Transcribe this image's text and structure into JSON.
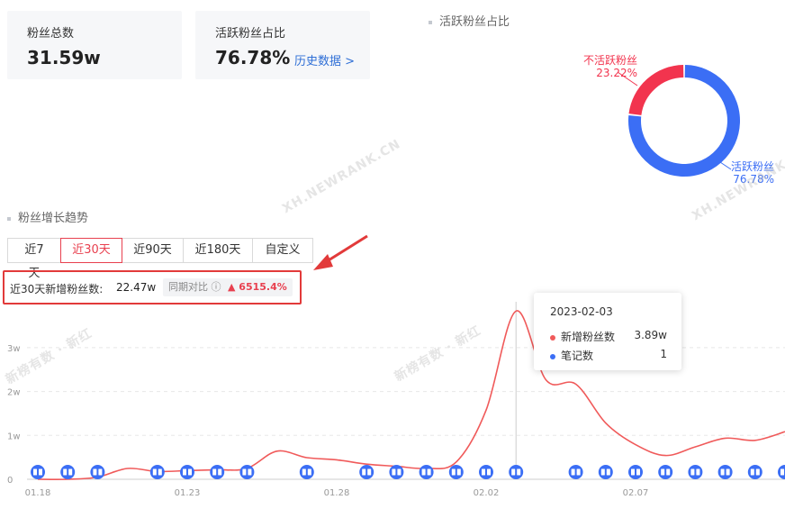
{
  "stats": {
    "fans_total_label": "粉丝总数",
    "fans_total_value": "31.59w",
    "active_ratio_label": "活跃粉丝占比",
    "active_ratio_value": "76.78%",
    "history_link": "历史数据 >"
  },
  "donut": {
    "title": "活跃粉丝占比",
    "inactive_label": "不活跃粉丝",
    "inactive_pct": "23.22%",
    "active_label": "活跃粉丝",
    "active_pct": "76.78%",
    "inactive_value": 23.22,
    "active_value": 76.78,
    "inactive_color": "#f2344e",
    "active_color": "#3b6ef5"
  },
  "trend": {
    "title": "粉丝增长趋势",
    "tabs": [
      "近7天",
      "近30天",
      "近90天",
      "近180天",
      "自定义"
    ],
    "active_tab": "近30天",
    "summary_label": "近30天新增粉丝数:",
    "summary_value": "22.47w",
    "yoy_label": "同期对比",
    "yoy_change": "6515.4%"
  },
  "tooltip": {
    "date": "2023-02-03",
    "row1_label": "新增粉丝数",
    "row1_value": "3.89w",
    "row2_label": "笔记数",
    "row2_value": "1"
  },
  "watermarks": [
    "XH.NEWRANK.CN",
    "XH.NEWRANK.CN",
    "新榜有数 · 新红",
    "新榜有数 · 新红"
  ],
  "chart_data": {
    "type": "line",
    "x": [
      "01.18",
      "01.19",
      "01.20",
      "01.21",
      "01.22",
      "01.23",
      "01.24",
      "01.25",
      "01.26",
      "01.27",
      "01.28",
      "01.29",
      "01.30",
      "01.31",
      "02.01",
      "02.02",
      "02.03",
      "02.04",
      "02.05",
      "02.06",
      "02.07",
      "02.08",
      "02.09",
      "02.10",
      "02.11",
      "02.12"
    ],
    "xtick_labels": [
      "01.18",
      "01.23",
      "01.28",
      "02.02",
      "02.07"
    ],
    "ytick_labels": [
      "0",
      "1w",
      "2w",
      "3w"
    ],
    "ylim": [
      0,
      4
    ],
    "series": [
      {
        "name": "新增粉丝数",
        "color": "#f05a5a",
        "values": [
          0.0,
          0.0,
          0.05,
          0.25,
          0.18,
          0.2,
          0.22,
          0.25,
          0.65,
          0.5,
          0.45,
          0.35,
          0.3,
          0.25,
          0.4,
          1.6,
          3.89,
          2.3,
          2.2,
          1.3,
          0.8,
          0.55,
          0.75,
          0.95,
          0.9,
          1.1
        ]
      },
      {
        "name": "笔记数",
        "color": "#3b6ef5",
        "values": [
          1,
          1,
          1,
          null,
          1,
          1,
          1,
          1,
          null,
          1,
          null,
          1,
          1,
          1,
          1,
          1,
          1,
          null,
          1,
          1,
          1,
          1,
          1,
          1,
          1,
          1
        ]
      }
    ],
    "grid": true
  }
}
